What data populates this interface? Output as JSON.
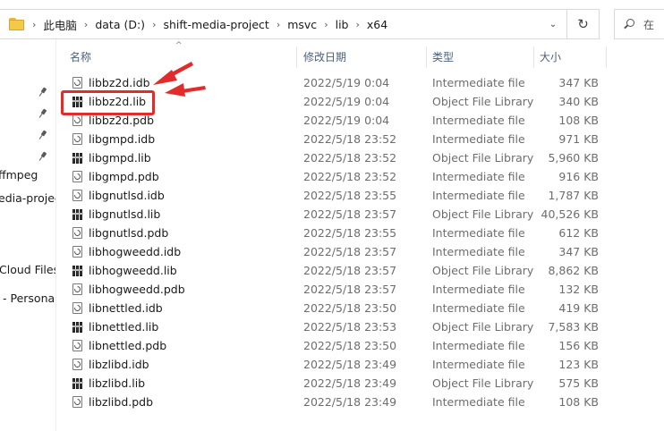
{
  "address_bar": {
    "crumbs": [
      "此电脑",
      "data (D:)",
      "shift-media-project",
      "msvc",
      "lib",
      "x64"
    ],
    "dropdown_glyph": "⌄",
    "refresh_glyph": "↻"
  },
  "search": {
    "placeholder": "在"
  },
  "nav_pane": {
    "items": [
      "ffmpeg",
      "edia-projec",
      "Cloud Files",
      "- Persona"
    ]
  },
  "columns": {
    "name": "名称",
    "date": "修改日期",
    "type": "类型",
    "size": "大小"
  },
  "files": [
    {
      "name": "libbz2d.idb",
      "date": "2022/5/19 0:04",
      "type": "Intermediate file",
      "size": "347 KB",
      "icon": "intermediate-file-icon"
    },
    {
      "name": "libbz2d.lib",
      "date": "2022/5/19 0:04",
      "type": "Object File Library",
      "size": "340 KB",
      "icon": "library-file-icon"
    },
    {
      "name": "libbz2d.pdb",
      "date": "2022/5/19 0:04",
      "type": "Intermediate file",
      "size": "108 KB",
      "icon": "intermediate-file-icon"
    },
    {
      "name": "libgmpd.idb",
      "date": "2022/5/18 23:52",
      "type": "Intermediate file",
      "size": "971 KB",
      "icon": "intermediate-file-icon"
    },
    {
      "name": "libgmpd.lib",
      "date": "2022/5/18 23:52",
      "type": "Object File Library",
      "size": "5,960 KB",
      "icon": "library-file-icon"
    },
    {
      "name": "libgmpd.pdb",
      "date": "2022/5/18 23:52",
      "type": "Intermediate file",
      "size": "916 KB",
      "icon": "intermediate-file-icon"
    },
    {
      "name": "libgnutlsd.idb",
      "date": "2022/5/18 23:55",
      "type": "Intermediate file",
      "size": "1,787 KB",
      "icon": "intermediate-file-icon"
    },
    {
      "name": "libgnutlsd.lib",
      "date": "2022/5/18 23:57",
      "type": "Object File Library",
      "size": "40,526 KB",
      "icon": "library-file-icon"
    },
    {
      "name": "libgnutlsd.pdb",
      "date": "2022/5/18 23:55",
      "type": "Intermediate file",
      "size": "612 KB",
      "icon": "intermediate-file-icon"
    },
    {
      "name": "libhogweedd.idb",
      "date": "2022/5/18 23:57",
      "type": "Intermediate file",
      "size": "347 KB",
      "icon": "intermediate-file-icon"
    },
    {
      "name": "libhogweedd.lib",
      "date": "2022/5/18 23:57",
      "type": "Object File Library",
      "size": "8,862 KB",
      "icon": "library-file-icon"
    },
    {
      "name": "libhogweedd.pdb",
      "date": "2022/5/18 23:57",
      "type": "Intermediate file",
      "size": "132 KB",
      "icon": "intermediate-file-icon"
    },
    {
      "name": "libnettled.idb",
      "date": "2022/5/18 23:50",
      "type": "Intermediate file",
      "size": "419 KB",
      "icon": "intermediate-file-icon"
    },
    {
      "name": "libnettled.lib",
      "date": "2022/5/18 23:53",
      "type": "Object File Library",
      "size": "7,583 KB",
      "icon": "library-file-icon"
    },
    {
      "name": "libnettled.pdb",
      "date": "2022/5/18 23:50",
      "type": "Intermediate file",
      "size": "156 KB",
      "icon": "intermediate-file-icon"
    },
    {
      "name": "libzlibd.idb",
      "date": "2022/5/18 23:49",
      "type": "Intermediate file",
      "size": "123 KB",
      "icon": "intermediate-file-icon"
    },
    {
      "name": "libzlibd.lib",
      "date": "2022/5/18 23:49",
      "type": "Object File Library",
      "size": "575 KB",
      "icon": "library-file-icon"
    },
    {
      "name": "libzlibd.pdb",
      "date": "2022/5/18 23:49",
      "type": "Intermediate file",
      "size": "108 KB",
      "icon": "intermediate-file-icon"
    }
  ],
  "annotation": {
    "highlighted_file": "libbz2d.lib",
    "color": "#e22b2b"
  },
  "colors": {
    "header_text": "#4c607a",
    "meta_text": "#6d6d6d",
    "folder": "#f5c84a"
  }
}
